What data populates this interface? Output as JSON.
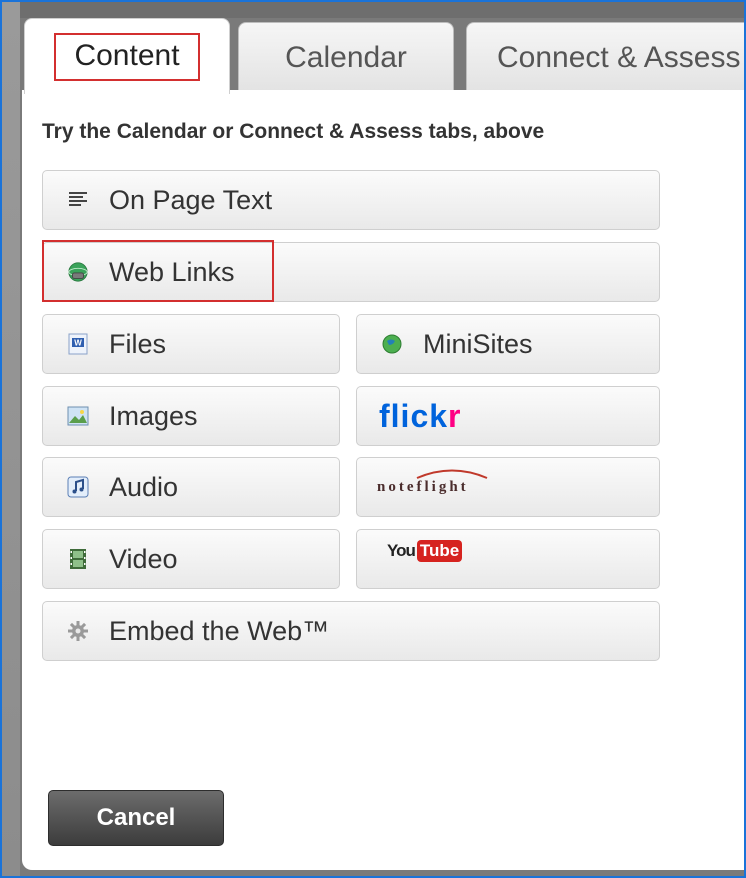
{
  "tabs": [
    {
      "label": "Content"
    },
    {
      "label": "Calendar"
    },
    {
      "label": "Connect & Assess"
    }
  ],
  "hint": "Try the Calendar or Connect & Assess tabs, above",
  "buttons": {
    "on_page_text": "On Page Text",
    "web_links": "Web Links",
    "files": "Files",
    "minisites": "MiniSites",
    "images": "Images",
    "flickr_a": "flick",
    "flickr_b": "r",
    "audio": "Audio",
    "noteflight": "noteflight",
    "video": "Video",
    "youtube_a": "You",
    "youtube_b": "Tube",
    "embed": "Embed the Web™"
  },
  "cancel_label": "Cancel",
  "colors": {
    "frame_border": "#1a73d9",
    "highlight": "#d32f2f",
    "flickr_blue": "#0063dc",
    "flickr_pink": "#ff0084",
    "youtube_red": "#d6231f"
  }
}
